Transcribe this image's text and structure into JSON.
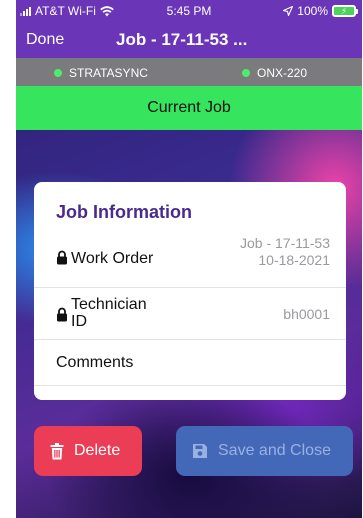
{
  "status": {
    "carrier": "AT&T Wi-Fi",
    "time": "5:45 PM",
    "battery_pct": "100%"
  },
  "nav": {
    "done_label": "Done",
    "title": "Job - 17-11-53 ..."
  },
  "devices": [
    {
      "name": "STRATASYNC",
      "status_color": "#4ded6b"
    },
    {
      "name": "ONX-220",
      "status_color": "#4ded6b"
    }
  ],
  "job_banner": "Current Job",
  "job_info": {
    "title": "Job Information",
    "rows": [
      {
        "label": "Work Order",
        "value_line1": "Job - 17-11-53",
        "value_line2": "10-18-2021",
        "icon": "lock-icon"
      },
      {
        "label_line1": "Technician",
        "label_line2": "ID",
        "value": "bh0001",
        "icon": "lock-icon"
      },
      {
        "label": "Comments"
      }
    ]
  },
  "actions": {
    "delete_label": "Delete",
    "save_label": "Save and Close"
  },
  "colors": {
    "nav": "#6a35b6",
    "device_bar": "#7b7b7e",
    "current_job": "#36e45e",
    "delete": "#ec3d56",
    "save_disabled": "#4368b8"
  }
}
